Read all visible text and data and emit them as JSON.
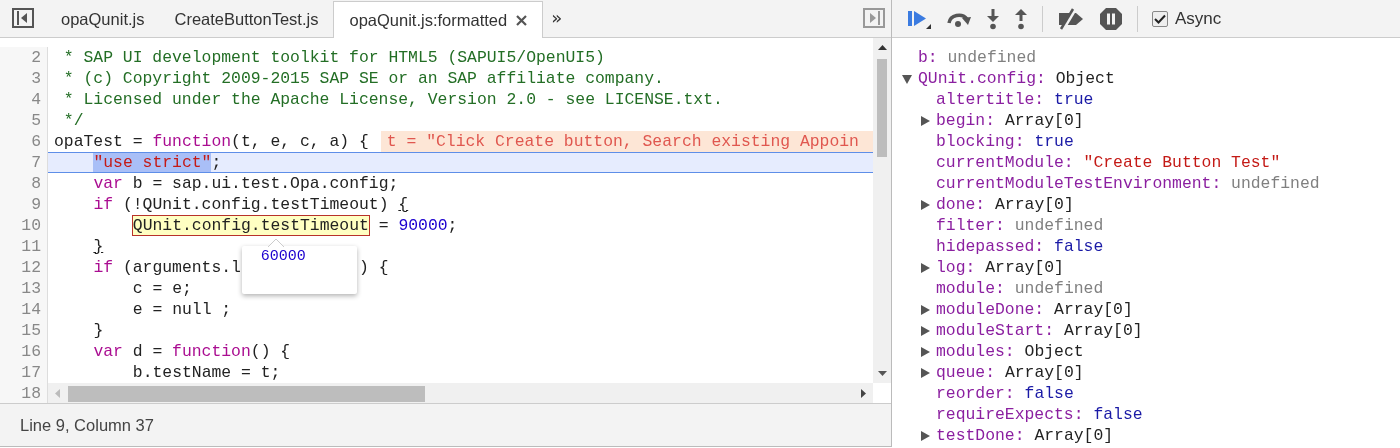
{
  "editor_tabs": {
    "tabs": [
      {
        "label": "opaQunit.js",
        "selected": false,
        "closable": false
      },
      {
        "label": "CreateButtonTest.js",
        "selected": false,
        "closable": false
      },
      {
        "label": "opaQunit.js:formatted",
        "selected": true,
        "closable": true
      }
    ],
    "overflow": "»"
  },
  "editor": {
    "lines": [
      {
        "number": "2",
        "current": false,
        "tokens": [
          {
            "t": " * SAP UI development toolkit for HTML5 (SAPUI5/OpenUI5)",
            "kind": "comment"
          }
        ]
      },
      {
        "number": "3",
        "current": false,
        "tokens": [
          {
            "t": " * (c) Copyright 2009-2015 SAP SE or an SAP affiliate company.",
            "kind": "comment"
          }
        ]
      },
      {
        "number": "4",
        "current": false,
        "tokens": [
          {
            "t": " * Licensed under the Apache License, Version 2.0 - see LICENSE.txt.",
            "kind": "comment"
          }
        ]
      },
      {
        "number": "5",
        "current": false,
        "tokens": [
          {
            "t": " */",
            "kind": "comment"
          }
        ]
      },
      {
        "number": "6",
        "current": false,
        "tokens": [
          {
            "t": "opaTest = ",
            "kind": "plain"
          },
          {
            "t": "function",
            "kind": "keyword"
          },
          {
            "t": "(t, e, c, a) {",
            "kind": "plain"
          }
        ],
        "inline_value": "t = \"Click Create button, Search existing Appoin",
        "children": [
          {
            "number": "7",
            "current": true,
            "tokens": [
              {
                "t": "\"use strict\"",
                "kind": "selected-string"
              },
              {
                "t": ";",
                "kind": "plain"
              }
            ]
          },
          {
            "number": "8",
            "current": false,
            "tokens": [
              {
                "t": "var",
                "kind": "keyword"
              },
              {
                "t": " b = sap.ui.test.Opa.config;",
                "kind": "plain"
              }
            ]
          },
          {
            "number": "9",
            "current": false,
            "tokens": [
              {
                "t": "if",
                "kind": "keyword"
              },
              {
                "t": " (!QUnit.config.testTimeout) ",
                "kind": "plain"
              },
              {
                "t": "{",
                "kind": "matching-brace"
              }
            ],
            "children": [
              {
                "number": "10",
                "current": false,
                "tokens": [
                  {
                    "t": "QUnit.config.testTimeout",
                    "kind": "hovered-expression"
                  },
                  {
                    "t": " = ",
                    "kind": "plain"
                  },
                  {
                    "t": "90000",
                    "kind": "number"
                  },
                  {
                    "t": ";",
                    "kind": "plain"
                  }
                ],
                "popover": "60000"
              }
            ]
          },
          {
            "number": "11",
            "current": false,
            "tokens": [
              {
                "t": "}",
                "kind": "matching-brace"
              }
            ]
          },
          {
            "number": "12",
            "current": false,
            "tokens": [
              {
                "t": "if",
                "kind": "keyword"
              },
              {
                "t": " (arguments.l",
                "kind": "plain"
              }
            ],
            "after_gap": [
              {
                "t": ") {",
                "kind": "plain"
              }
            ],
            "children": [
              {
                "number": "13",
                "current": false,
                "tokens": [
                  {
                    "t": "c = e;",
                    "kind": "plain"
                  }
                ]
              },
              {
                "number": "14",
                "current": false,
                "tokens": [
                  {
                    "t": "e = null ;",
                    "kind": "plain"
                  }
                ]
              }
            ]
          },
          {
            "number": "15",
            "current": false,
            "tokens": [
              {
                "t": "}",
                "kind": "plain"
              }
            ]
          },
          {
            "number": "16",
            "current": false,
            "tokens": [
              {
                "t": "var",
                "kind": "keyword"
              },
              {
                "t": " d = ",
                "kind": "plain"
              },
              {
                "t": "function",
                "kind": "keyword"
              },
              {
                "t": "() {",
                "kind": "plain"
              }
            ],
            "children": [
              {
                "number": "17",
                "current": false,
                "tokens": [
                  {
                    "t": "b.testName = t;",
                    "kind": "plain"
                  }
                ]
              }
            ]
          },
          {
            "number": "18"
          }
        ]
      }
    ]
  },
  "status_bar": {
    "text": "Line 9, Column 37"
  },
  "debugger": {
    "toolbar": {
      "async": {
        "label": "Async",
        "checked": true
      }
    },
    "scope": [
      {
        "name": "b:",
        "value": {
          "text": "undefined",
          "kind": "undefined"
        },
        "kind": "leaf"
      },
      {
        "name": "QUnit.config:",
        "value": {
          "text": "Object",
          "kind": "object"
        },
        "kind": "node",
        "expanded": true,
        "children": [
          {
            "name": "altertitle:",
            "value": {
              "text": "true",
              "kind": "boolean"
            },
            "kind": "leaf"
          },
          {
            "name": "begin:",
            "value": {
              "text": "Array[0]",
              "kind": "object"
            },
            "kind": "node",
            "expanded": false
          },
          {
            "name": "blocking:",
            "value": {
              "text": "true",
              "kind": "boolean"
            },
            "kind": "leaf"
          },
          {
            "name": "currentModule:",
            "value": {
              "text": "\"Create Button Test\"",
              "kind": "string"
            },
            "kind": "leaf"
          },
          {
            "name": "currentModuleTestEnvironment:",
            "value": {
              "text": "undefined",
              "kind": "undefined"
            },
            "kind": "leaf"
          },
          {
            "name": "done:",
            "value": {
              "text": "Array[0]",
              "kind": "object"
            },
            "kind": "node",
            "expanded": false
          },
          {
            "name": "filter:",
            "value": {
              "text": "undefined",
              "kind": "undefined"
            },
            "kind": "leaf"
          },
          {
            "name": "hidepassed:",
            "value": {
              "text": "false",
              "kind": "boolean"
            },
            "kind": "leaf"
          },
          {
            "name": "log:",
            "value": {
              "text": "Array[0]",
              "kind": "object"
            },
            "kind": "node",
            "expanded": false
          },
          {
            "name": "module:",
            "value": {
              "text": "undefined",
              "kind": "undefined"
            },
            "kind": "leaf"
          },
          {
            "name": "moduleDone:",
            "value": {
              "text": "Array[0]",
              "kind": "object"
            },
            "kind": "node",
            "expanded": false
          },
          {
            "name": "moduleStart:",
            "value": {
              "text": "Array[0]",
              "kind": "object"
            },
            "kind": "node",
            "expanded": false
          },
          {
            "name": "modules:",
            "value": {
              "text": "Object",
              "kind": "object"
            },
            "kind": "node",
            "expanded": false
          },
          {
            "name": "queue:",
            "value": {
              "text": "Array[0]",
              "kind": "object"
            },
            "kind": "node",
            "expanded": false
          },
          {
            "name": "reorder:",
            "value": {
              "text": "false",
              "kind": "boolean"
            },
            "kind": "leaf"
          },
          {
            "name": "requireExpects:",
            "value": {
              "text": "false",
              "kind": "boolean"
            },
            "kind": "leaf"
          },
          {
            "name": "testDone:",
            "value": {
              "text": "Array[0]",
              "kind": "object"
            },
            "kind": "node",
            "expanded": false
          }
        ]
      }
    ]
  }
}
